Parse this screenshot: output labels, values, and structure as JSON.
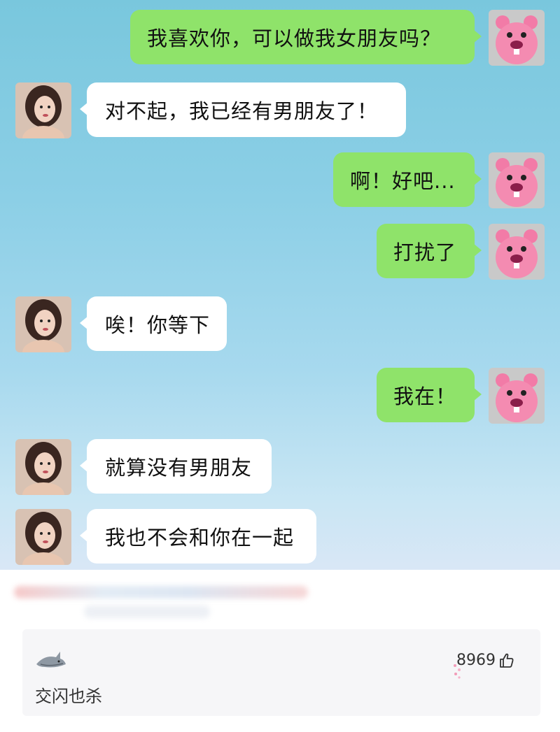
{
  "chat": {
    "messages": [
      {
        "side": "right",
        "text": "我喜欢你，可以做我女朋友吗？"
      },
      {
        "side": "left",
        "text": "对不起，我已经有男朋友了！"
      },
      {
        "side": "right",
        "text": "啊！好吧..."
      },
      {
        "side": "right",
        "text": "打扰了"
      },
      {
        "side": "left",
        "text": "唉！你等下"
      },
      {
        "side": "right",
        "text": "我在！"
      },
      {
        "side": "left",
        "text": "就算没有男朋友"
      },
      {
        "side": "left",
        "text": "我也不会和你在一起"
      }
    ],
    "avatars": {
      "self": "pink-beaver-avatar",
      "other": "girl-photo-avatar"
    },
    "colors": {
      "sent_bubble": "#8fe36a",
      "received_bubble": "#ffffff"
    }
  },
  "comment": {
    "text": "交闪也杀",
    "likes": "8969",
    "like_icon": "thumbs-up-icon",
    "avatar_icon": "shark-avatar-icon"
  }
}
